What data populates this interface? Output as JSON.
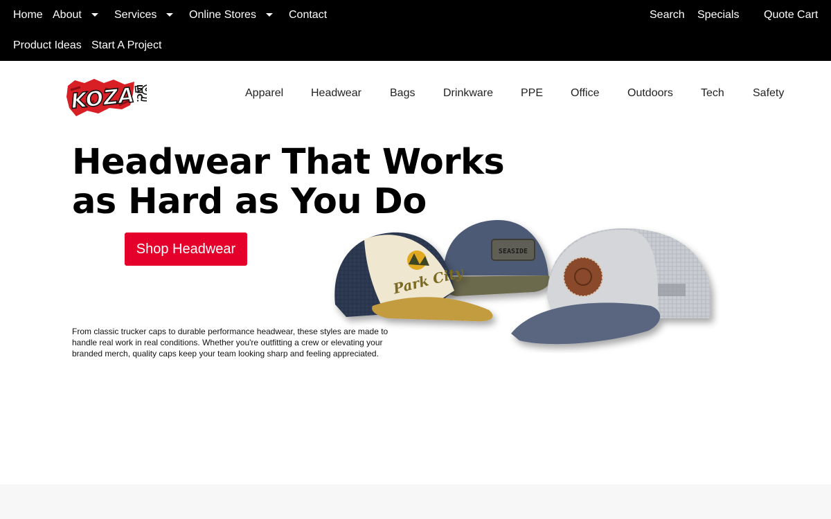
{
  "topbar": {
    "row1": [
      {
        "label": "Home"
      },
      {
        "label": "About",
        "has_dropdown": true
      },
      {
        "label": "Services",
        "has_dropdown": true
      },
      {
        "label": "Online Stores",
        "has_dropdown": true
      },
      {
        "label": "Contact"
      }
    ],
    "right": {
      "search": "Search",
      "specials": "Specials",
      "quote_cart": "Quote Cart"
    },
    "row2": [
      {
        "label": "Product Ideas"
      },
      {
        "label": "Start A Project"
      }
    ]
  },
  "logo": {
    "name": "KOZA'S",
    "suffix": "INC.",
    "icon": "kozas-logo"
  },
  "categories": [
    "Apparel",
    "Headwear",
    "Bags",
    "Drinkware",
    "PPE",
    "Office",
    "Outdoors",
    "Tech",
    "Safety"
  ],
  "hero": {
    "title_line1": "Headwear That Works",
    "title_line2": "as Hard as You Do",
    "button": "Shop Headwear",
    "description": "From classic trucker caps to durable performance headwear, these styles are made to handle real work in real conditions. Whether you're outfitting a crew or elevating your branded merch, quality caps keep your team looking sharp and feeling appreciated.",
    "cap_patch_left": "Park City",
    "cap_patch_middle": "SEASIDE"
  },
  "colors": {
    "accent": "#e4002b",
    "topbar": "#000000",
    "footer_band": "#f7f7f7"
  }
}
